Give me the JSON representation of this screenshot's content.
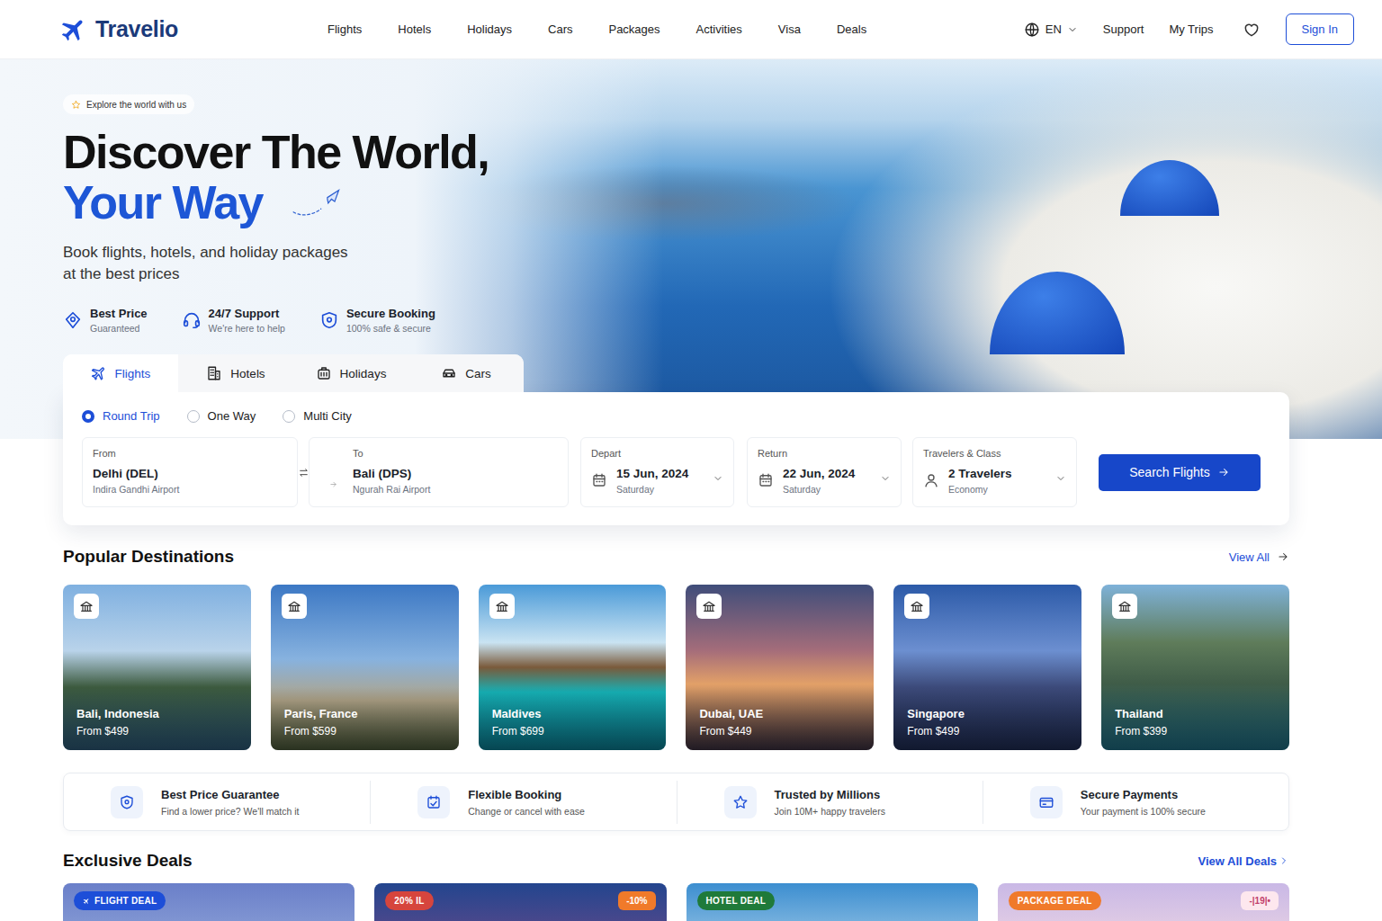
{
  "brand": {
    "name": "Travelio"
  },
  "nav": [
    "Flights",
    "Hotels",
    "Holidays",
    "Cars",
    "Packages",
    "Activities",
    "Visa",
    "Deals"
  ],
  "header_actions": {
    "language": "EN",
    "links": [
      "Support",
      "My Trips"
    ],
    "sign_in": "Sign In"
  },
  "hero": {
    "eyebrow": "Explore the world with us",
    "title": "Discover The World,",
    "title_accent": "Your Way",
    "subtitle_lines": [
      "Book flights, hotels, and holiday packages",
      "at the best prices"
    ],
    "features": [
      {
        "title": "Best Price",
        "subtitle": "Guaranteed"
      },
      {
        "title": "24/7 Support",
        "subtitle": "We're here to help"
      },
      {
        "title": "Secure Booking",
        "subtitle": "100% safe & secure"
      }
    ]
  },
  "search": {
    "tabs": [
      {
        "label": "Flights",
        "selected": true
      },
      {
        "label": "Hotels",
        "selected": false
      },
      {
        "label": "Holidays",
        "selected": false
      },
      {
        "label": "Cars",
        "selected": false
      }
    ],
    "trip_types": [
      {
        "label": "Round Trip",
        "selected": true
      },
      {
        "label": "One Way",
        "selected": false
      },
      {
        "label": "Multi City",
        "selected": false
      }
    ],
    "from": {
      "label": "From",
      "value": "Delhi (DEL)",
      "detail": "Indira Gandhi Airport"
    },
    "to": {
      "label": "To",
      "value": "Bali (DPS)",
      "detail": "Ngurah Rai Airport"
    },
    "depart": {
      "label": "Depart",
      "value": "15 Jun, 2024",
      "detail": "Saturday"
    },
    "return": {
      "label": "Return",
      "value": "22 Jun, 2024",
      "detail": "Saturday"
    },
    "travelers": {
      "label": "Travelers & Class",
      "value": "2 Travelers",
      "detail": "Economy"
    },
    "button": "Search Flights"
  },
  "destinations": {
    "title": "Popular Destinations",
    "view_all": "View All",
    "items": [
      {
        "name": "Bali, Indonesia",
        "price": "From $499"
      },
      {
        "name": "Paris, France",
        "price": "From $599"
      },
      {
        "name": "Maldives",
        "price": "From $699"
      },
      {
        "name": "Dubai, UAE",
        "price": "From $449"
      },
      {
        "name": "Singapore",
        "price": "From $499"
      },
      {
        "name": "Thailand",
        "price": "From $399"
      }
    ]
  },
  "benefits": [
    {
      "title": "Best Price Guarantee",
      "subtitle": "Find a lower price? We'll match it"
    },
    {
      "title": "Flexible Booking",
      "subtitle": "Change or cancel with ease"
    },
    {
      "title": "Trusted by Millions",
      "subtitle": "Join 10M+ happy travelers"
    },
    {
      "title": "Secure Payments",
      "subtitle": "Your payment is 100% secure"
    }
  ],
  "deals": {
    "title": "Exclusive Deals",
    "view_all": "View All Deals",
    "items": [
      {
        "badge": "FLIGHT DEAL",
        "color": "#1d4ed8"
      },
      {
        "badge": "20% IL",
        "color": "#d6453d",
        "discount": {
          "text": "-10%",
          "color": "#f07a2a",
          "kind": "solid"
        }
      },
      {
        "badge": "HOTEL DEAL",
        "color": "#1f7a3a"
      },
      {
        "badge": "PACKAGE DEAL",
        "color": "#f07a2a",
        "discount": {
          "text": "-|19|•",
          "color": "#c2416c",
          "kind": "soft"
        }
      }
    ]
  }
}
